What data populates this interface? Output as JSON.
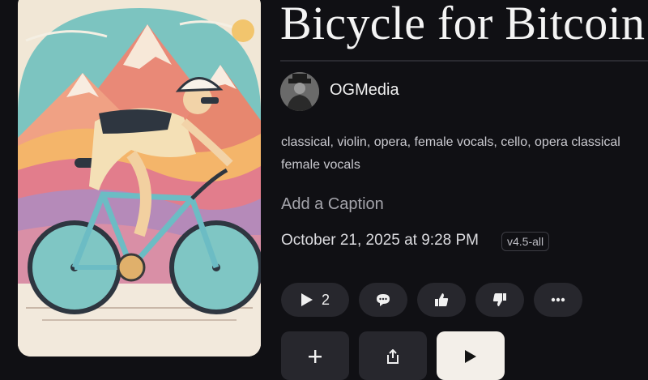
{
  "song": {
    "title": "Bicycle for Bitcoin",
    "artist": "OGMedia",
    "tags": "classical, violin, opera, female vocals, cello, opera classical female vocals",
    "caption_placeholder": "Add a Caption",
    "date": "October 21, 2025 at 9:28 PM",
    "version": "v4.5-all"
  },
  "actions": {
    "play_count": "2",
    "icons": [
      "play-icon",
      "comment-icon",
      "thumbs-up-icon",
      "thumbs-down-icon",
      "more-icon",
      "plus-icon",
      "share-icon",
      "play-icon"
    ]
  },
  "colors": {
    "background": "#101014",
    "button": "#27272d",
    "primary_button": "#f3efe9"
  }
}
